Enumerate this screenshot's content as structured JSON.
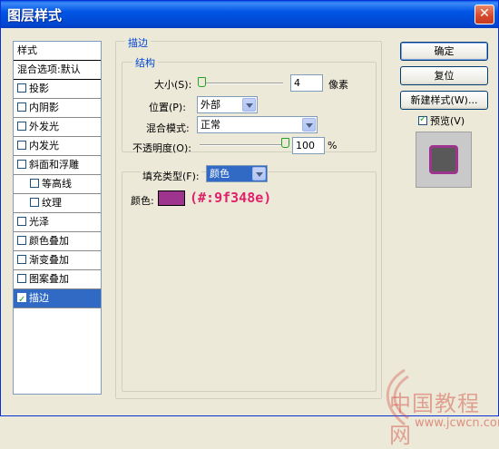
{
  "window": {
    "title": "图层样式",
    "close": "✕"
  },
  "styles_list": {
    "header": "样式",
    "blend": "混合选项:默认",
    "items": [
      {
        "label": "投影",
        "checked": false,
        "sub": false
      },
      {
        "label": "内阴影",
        "checked": false,
        "sub": false
      },
      {
        "label": "外发光",
        "checked": false,
        "sub": false
      },
      {
        "label": "内发光",
        "checked": false,
        "sub": false
      },
      {
        "label": "斜面和浮雕",
        "checked": false,
        "sub": false
      },
      {
        "label": "等高线",
        "checked": false,
        "sub": true
      },
      {
        "label": "纹理",
        "checked": false,
        "sub": true
      },
      {
        "label": "光泽",
        "checked": false,
        "sub": false
      },
      {
        "label": "颜色叠加",
        "checked": false,
        "sub": false
      },
      {
        "label": "渐变叠加",
        "checked": false,
        "sub": false
      },
      {
        "label": "图案叠加",
        "checked": false,
        "sub": false
      },
      {
        "label": "描边",
        "checked": true,
        "sub": false,
        "selected": true
      }
    ]
  },
  "stroke": {
    "group_title": "描边",
    "structure_title": "结构",
    "size_label": "大小(S):",
    "size_value": "4",
    "size_unit": "像素",
    "size_slider_fraction": 0.0,
    "position_label": "位置(P):",
    "position_value": "外部",
    "blend_mode_label": "混合模式:",
    "blend_mode_value": "正常",
    "opacity_label": "不透明度(O):",
    "opacity_value": "100",
    "opacity_unit": "%",
    "opacity_slider_fraction": 1.0,
    "fill_type_label": "填充类型(F):",
    "fill_type_value": "颜色",
    "color_label": "颜色:",
    "color_hex": "#9f348e",
    "color_annotation": "(#:9f348e)"
  },
  "buttons": {
    "ok": "确定",
    "reset": "复位",
    "new_style": "新建样式(W)...",
    "preview": "预览(V)",
    "preview_checked": true
  },
  "watermark": {
    "line1": "中国教程网",
    "line2": "www.jcwcn.com"
  }
}
